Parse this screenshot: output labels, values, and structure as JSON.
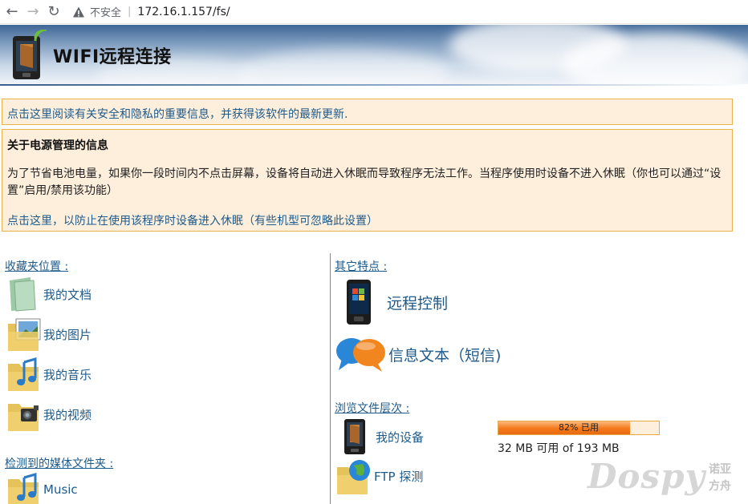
{
  "browser": {
    "security_label": "不安全",
    "url": "172.16.1.157/fs/"
  },
  "header": {
    "title": "WIFI远程连接"
  },
  "notice1": {
    "link": "点击这里阅读有关安全和隐私的重要信息，并获得该软件的最新更新."
  },
  "notice2": {
    "title": "关于电源管理的信息",
    "body": "为了节省电池电量，如果你一段时间内不点击屏幕，设备将自动进入休眠而导致程序无法工作。当程序使用时设备不进入休眠（你也可以通过“设置”启用/禁用该功能）",
    "link": "点击这里，以防止在使用该程序时设备进入休眠（有些机型可忽略此设置）"
  },
  "favorites": {
    "title": "收藏夹位置 :",
    "items": [
      {
        "label": "我的文档",
        "icon": "documents-folder-icon"
      },
      {
        "label": "我的图片",
        "icon": "pictures-folder-icon"
      },
      {
        "label": "我的音乐",
        "icon": "music-folder-icon"
      },
      {
        "label": "我的视频",
        "icon": "video-folder-icon"
      }
    ]
  },
  "media": {
    "title": "检测到的媒体文件夹 :",
    "items": [
      {
        "label": "Music",
        "icon": "music-folder-icon"
      }
    ]
  },
  "features": {
    "title": "其它特点 :",
    "items": [
      {
        "label": "远程控制",
        "icon": "phone-icon"
      },
      {
        "label": "信息文本（短信)",
        "icon": "chat-bubbles-icon"
      }
    ]
  },
  "browse": {
    "title": "浏览文件层次 :",
    "items": [
      {
        "label": "我的设备",
        "icon": "device-icon"
      },
      {
        "label": "FTP 探测",
        "icon": "ftp-globe-icon"
      }
    ],
    "usage_percent": 82,
    "usage_label": "82% 已用",
    "storage_text": "32 MB 可用 of 193 MB"
  },
  "watermark": {
    "text": "Dospy",
    "cn_line1": "诺亚",
    "cn_line2": "方舟"
  },
  "colors": {
    "link": "#1e5a8a",
    "notice_bg": "#fdefdc",
    "notice_border": "#e9b24a",
    "progress": "#f4781c"
  }
}
